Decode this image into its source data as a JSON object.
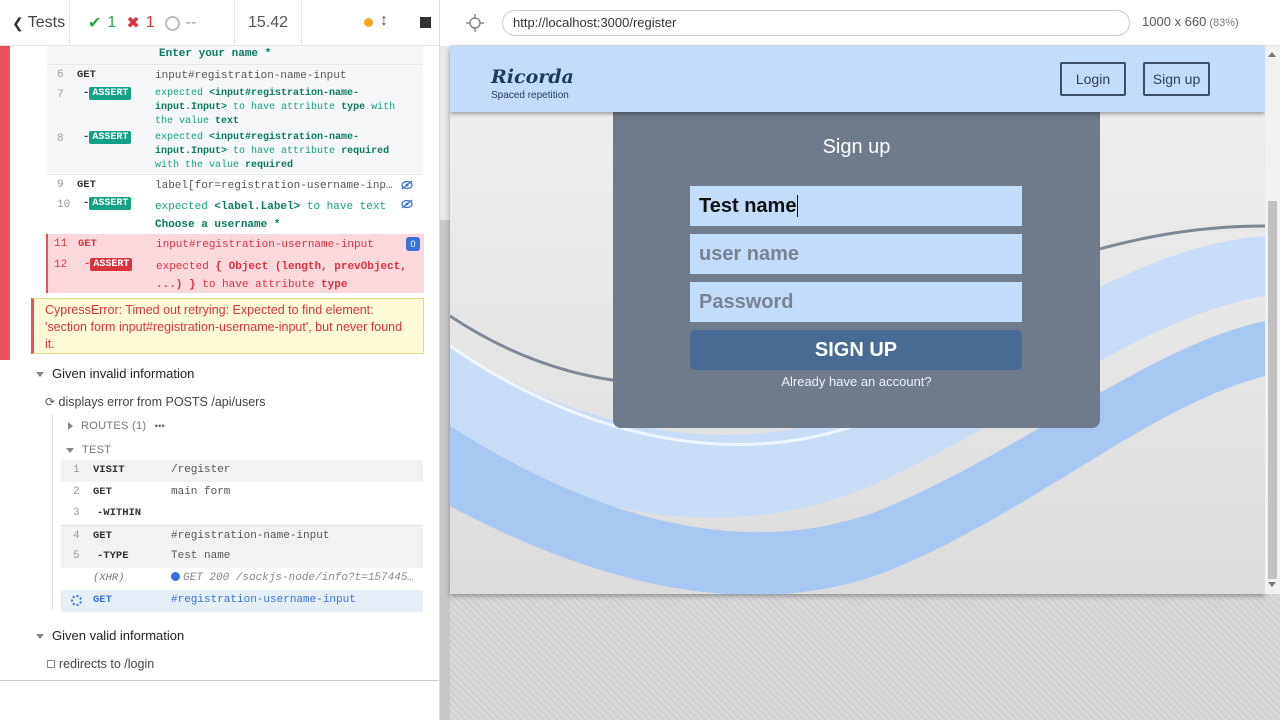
{
  "reporter": {
    "back_label": "Tests",
    "passed": "1",
    "failed": "1",
    "pending": "--",
    "duration": "15.42"
  },
  "log": {
    "label_text": "Enter your name *",
    "rows": [
      {
        "num": "6",
        "cmd": "GET",
        "msg": "input#registration-name-input"
      },
      {
        "num": "7",
        "cmd": "ASSERT",
        "msg_a": "expected",
        "msg_b": "<input#registration-name-input.Input>",
        "msg_c": "to have attribute",
        "msg_d": "type",
        "msg_e": "with the value",
        "msg_f": "text"
      },
      {
        "num": "8",
        "cmd": "ASSERT",
        "msg_a": "expected",
        "msg_b": "<input#registration-name-input.Input>",
        "msg_c": "to have attribute",
        "msg_d": "required",
        "msg_e": "with the value",
        "msg_f": "required"
      },
      {
        "num": "9",
        "cmd": "GET",
        "msg": "label[for=registration-username-inp…"
      },
      {
        "num": "10",
        "cmd": "ASSERT",
        "msg_a": "expected",
        "msg_b": "<label.Label>",
        "msg_c": "to have text",
        "msg_d": "Choose a username *"
      },
      {
        "num": "11",
        "cmd": "GET",
        "msg": "input#registration-username-input",
        "badge": "0"
      },
      {
        "num": "12",
        "cmd": "ASSERT",
        "msg_a": "expected",
        "msg_b": "{ Object (length, prevObject, ...) }",
        "msg_c": "to have attribute",
        "msg_d": "type"
      }
    ]
  },
  "error": "CypressError: Timed out retrying: Expected to find element: 'section form input#registration-username-input', but never found it.",
  "suite_invalid": {
    "title": "Given invalid information",
    "test_title": "displays error from POSTS /api/users",
    "routes_label": "ROUTES (1)",
    "routes_more": "•••",
    "test_label": "TEST",
    "commands": [
      {
        "num": "1",
        "cmd": "VISIT",
        "msg": "/register"
      },
      {
        "num": "2",
        "cmd": "GET",
        "msg": "main form"
      },
      {
        "num": "3",
        "cmd": "-WITHIN",
        "msg": ""
      },
      {
        "num": "4",
        "cmd": "GET",
        "msg": "#registration-name-input"
      },
      {
        "num": "5",
        "cmd": "-TYPE",
        "msg": "Test name"
      },
      {
        "num": "",
        "cmd": "(XHR)",
        "msg": "GET 200 /sockjs-node/info?t=157445…"
      },
      {
        "num": "",
        "cmd": "GET",
        "msg": "#registration-username-input"
      }
    ]
  },
  "suite_valid": {
    "title": "Given valid information",
    "test_title": "redirects to /login"
  },
  "aut": {
    "url": "http://localhost:3000/register",
    "viewport": "1000 x 660",
    "scale": "(83%)"
  },
  "app": {
    "logo": "Ricorda",
    "logo_sub": "Spaced repetition",
    "login": "Login",
    "signup": "Sign up",
    "card_title": "Sign up",
    "name_value": "Test name",
    "username_placeholder": "user name",
    "password_placeholder": "Password",
    "submit": "SIGN UP",
    "already": "Already have an account?"
  },
  "colors": {
    "pass": "#2aa44a",
    "fail": "#d9333f",
    "assert": "#16a086",
    "nav_bg": "#c4dcfb",
    "card_bg": "#6f7a8a",
    "submit_bg": "#4a6a96"
  }
}
